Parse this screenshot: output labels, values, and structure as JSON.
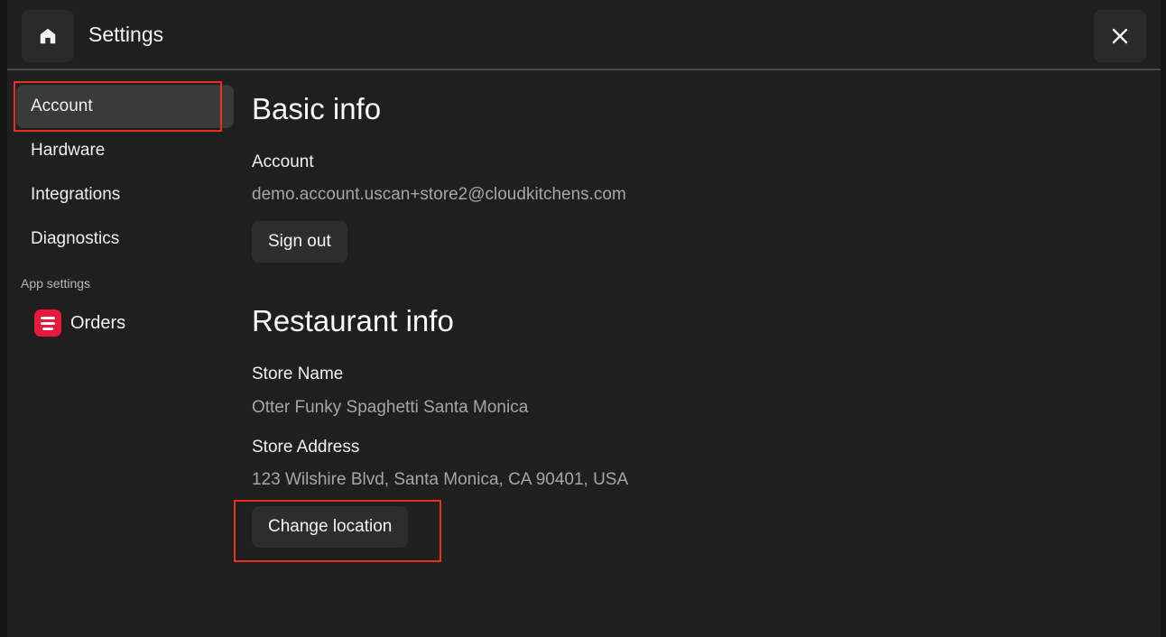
{
  "header": {
    "title": "Settings",
    "home_icon": "home-icon",
    "close_icon": "close-icon"
  },
  "sidebar": {
    "items": [
      {
        "label": "Account",
        "active": true
      },
      {
        "label": "Hardware",
        "active": false
      },
      {
        "label": "Integrations",
        "active": false
      },
      {
        "label": "Diagnostics",
        "active": false
      }
    ],
    "section_label": "App settings",
    "apps": [
      {
        "label": "Orders",
        "icon": "orders-app-icon",
        "icon_color": "#e8193c"
      }
    ]
  },
  "basic_info": {
    "heading": "Basic info",
    "account_label": "Account",
    "account_value": "demo.account.uscan+store2@cloudkitchens.com",
    "sign_out_label": "Sign out"
  },
  "restaurant_info": {
    "heading": "Restaurant info",
    "store_name_label": "Store Name",
    "store_name_value": "Otter Funky Spaghetti Santa Monica",
    "store_address_label": "Store Address",
    "store_address_value": "123 Wilshire Blvd, Santa Monica, CA 90401, USA",
    "change_location_label": "Change location"
  },
  "colors": {
    "background": "#1f1f1f",
    "highlight": "#e8321f",
    "active_item": "#3a3a3a"
  }
}
